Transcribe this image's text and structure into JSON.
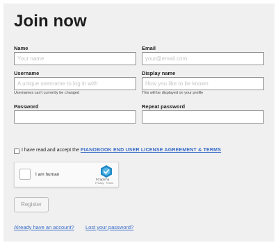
{
  "title": "Join now",
  "fields": {
    "name": {
      "label": "Name",
      "placeholder": "Your name"
    },
    "email": {
      "label": "Email",
      "placeholder": "your@email.com"
    },
    "username": {
      "label": "Username",
      "placeholder": "A unique username to log in with",
      "hint": "Usernames can't currently be changed"
    },
    "display_name": {
      "label": "Display name",
      "placeholder": "How you like to be known",
      "hint": "This will be displayed on your profile"
    },
    "password": {
      "label": "Password",
      "placeholder": ""
    },
    "repeat_password": {
      "label": "Repeat password",
      "placeholder": ""
    }
  },
  "terms": {
    "text": "I have read and accept the",
    "link": "PIANOBOOK END USER LICENSE AGREEMENT & TERMS"
  },
  "captcha": {
    "label": "I am human",
    "brand": "hCaptcha",
    "links": "Privacy  ·  Terms"
  },
  "register_label": "Register",
  "links": {
    "account": "Already have an account?",
    "password": "Lost your password?"
  },
  "colors": {
    "background": "#f0f0f0",
    "link": "#3a6cc9",
    "captcha_logo": "#1f88c5"
  }
}
